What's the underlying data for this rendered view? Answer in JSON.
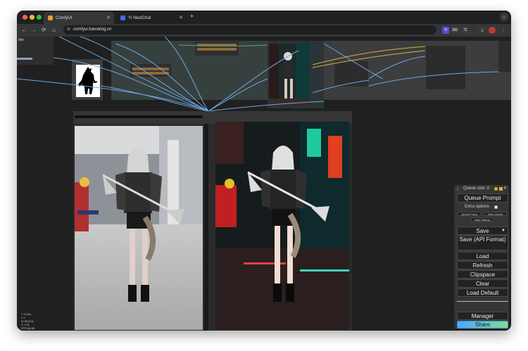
{
  "browser": {
    "tabs": [
      {
        "title": "ComfyUI",
        "active": true
      },
      {
        "title": "YI NextChat",
        "active": false
      }
    ],
    "new_tab": "+",
    "tab_menu": "⌄",
    "url": "comfyui.hansking.cn",
    "nav": {
      "back": "←",
      "forward": "→",
      "reload": "⟳",
      "home": "⌂"
    },
    "extensions": [
      {
        "label": "Yi",
        "color": "#5a4bd6"
      },
      {
        "label": "182",
        "color": "#3a3b3c"
      },
      {
        "label": "❐",
        "color": "#3a3b3c"
      },
      {
        "label": "⤓",
        "color": "#3a3b3c"
      },
      {
        "label": "",
        "color": "#c0392b"
      },
      {
        "label": "⋮",
        "color": "#353638"
      }
    ]
  },
  "app": {
    "status": "Idle",
    "stats": [
      "T: 0.00s",
      "I: 0",
      "N: 86 [14]",
      "V: 176",
      "FPS:58.88"
    ]
  },
  "menu": {
    "queue_size": "Queue size: 0",
    "queue_prompt": "Queue Prompt",
    "extra_options": "Extra options",
    "queue_front": "Queue Front",
    "view_queue": "View Queue",
    "view_history": "View History",
    "save": "Save",
    "save_api": "Save (API Format)",
    "load": "Load",
    "refresh": "Refresh",
    "clipspace": "Clipspace",
    "clear": "Clear",
    "load_default": "Load Default",
    "manager": "Manager",
    "share": "Share"
  },
  "colors": {
    "canvas": "#202020",
    "node": "#353535",
    "group": "#3b4446",
    "link_blue": "#6fa8dc",
    "link_yellow": "#d9b13a",
    "share_gradient_start": "#4fa8ff",
    "share_gradient_end": "#7fe08a"
  }
}
